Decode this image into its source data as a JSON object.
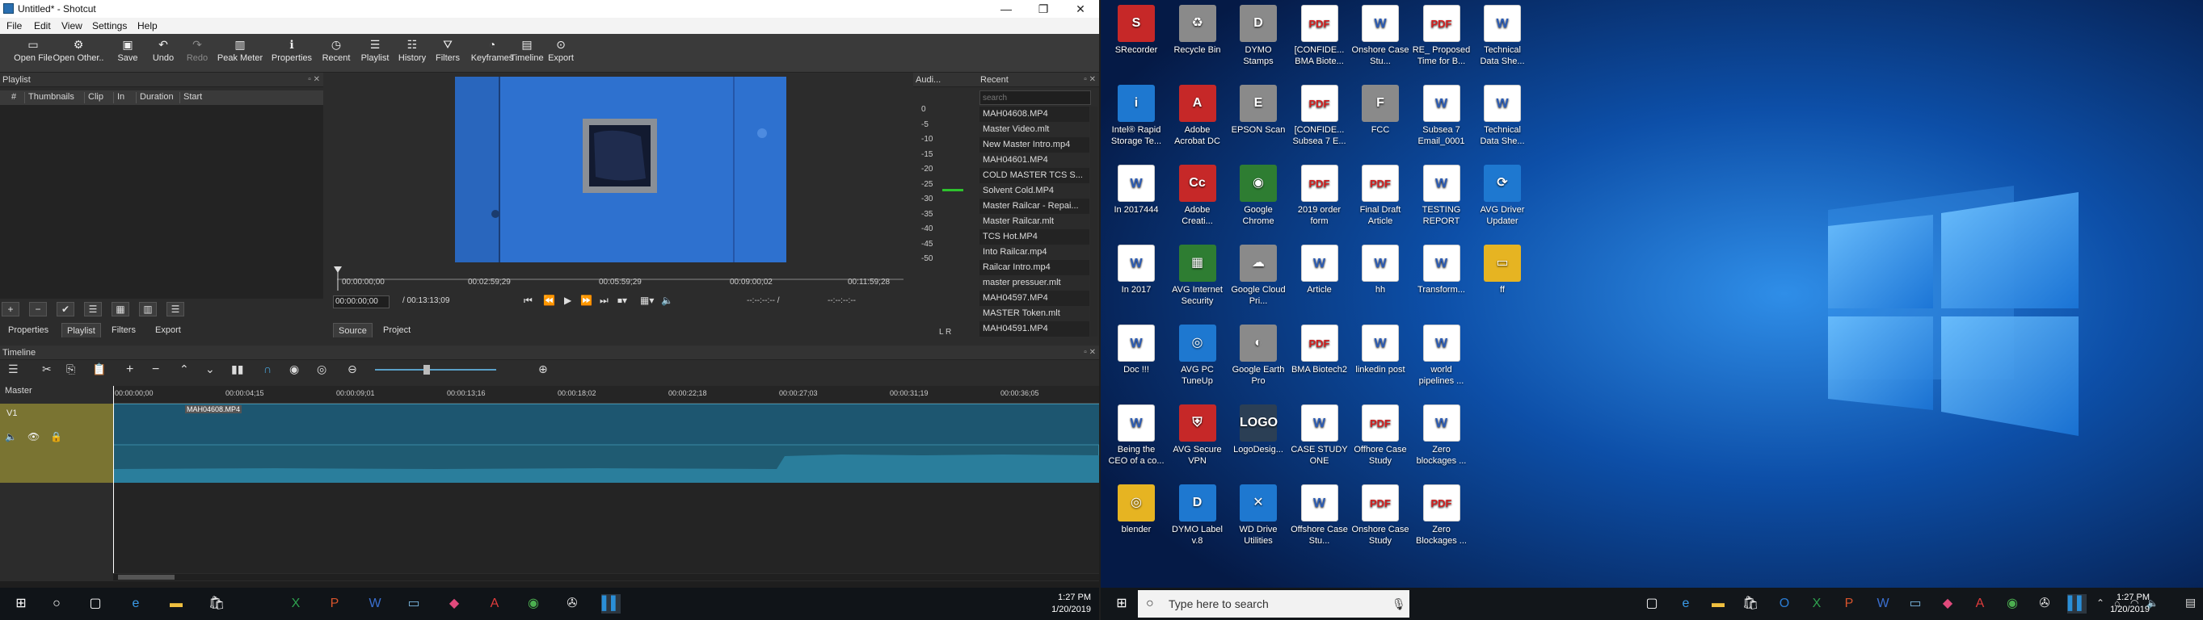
{
  "window": {
    "title": "Untitled* - Shotcut",
    "minimize": "—",
    "restore": "❐",
    "close": "✕"
  },
  "menu": [
    "File",
    "Edit",
    "View",
    "Settings",
    "Help"
  ],
  "toolbar": [
    {
      "label": "Open File",
      "icon": "open-file-icon",
      "glyph": "▭"
    },
    {
      "label": "Open Other..",
      "icon": "open-other-icon",
      "glyph": "⚙"
    },
    {
      "label": "Save",
      "icon": "save-icon",
      "glyph": "▣"
    },
    {
      "label": "Undo",
      "icon": "undo-icon",
      "glyph": "↶"
    },
    {
      "label": "Redo",
      "icon": "redo-icon",
      "glyph": "↷"
    },
    {
      "label": "Peak Meter",
      "icon": "peak-meter-icon",
      "glyph": "▥"
    },
    {
      "label": "Properties",
      "icon": "properties-icon",
      "glyph": "ℹ"
    },
    {
      "label": "Recent",
      "icon": "recent-icon",
      "glyph": "◷"
    },
    {
      "label": "Playlist",
      "icon": "playlist-icon",
      "glyph": "☰"
    },
    {
      "label": "History",
      "icon": "history-icon",
      "glyph": "☷"
    },
    {
      "label": "Filters",
      "icon": "filters-icon",
      "glyph": "⛛"
    },
    {
      "label": "Keyframes",
      "icon": "keyframes-icon",
      "glyph": "◔"
    },
    {
      "label": "Timeline",
      "icon": "timeline-icon",
      "glyph": "▤"
    },
    {
      "label": "Export",
      "icon": "export-icon",
      "glyph": "⊙"
    }
  ],
  "playlist": {
    "title": "Playlist",
    "columns": [
      "#",
      "Thumbnails",
      "Clip",
      "In",
      "Duration",
      "Start"
    ],
    "tabs": [
      "Properties",
      "Playlist",
      "Filters",
      "Export"
    ],
    "tools": [
      "+",
      "−",
      "✔",
      "☰",
      "▦",
      "▥",
      "☰"
    ]
  },
  "player": {
    "scale_ticks": [
      "00:00:00;00",
      "00:02:59;29",
      "00:05:59;29",
      "00:09:00;02",
      "00:11:59;28"
    ],
    "position": "00:00:00;00",
    "duration": "/ 00:13:13;09",
    "in_point": "--:--:--:-- /",
    "out_point": "--:--:--:--",
    "tabs": [
      "Source",
      "Project"
    ]
  },
  "audio": {
    "title": "Audi...",
    "scale": [
      "0",
      "-5",
      "-10",
      "-15",
      "-20",
      "-25",
      "-30",
      "-35",
      "-40",
      "-45",
      "-50"
    ],
    "channels": "L  R"
  },
  "recent": {
    "title": "Recent",
    "search_placeholder": "search",
    "items": [
      "MAH04608.MP4",
      "Master Video.mlt",
      "New Master Intro.mp4",
      "MAH04601.MP4",
      "COLD MASTER TCS S...",
      "Solvent Cold.MP4",
      "Master Railcar - Repai...",
      "Master Railcar.mlt",
      "TCS Hot.MP4",
      "Into Railcar.mp4",
      "Railcar Intro.mp4",
      "master pressuer.mlt",
      "MAH04597.MP4",
      "MASTER Token.mlt",
      "MAH04591.MP4"
    ]
  },
  "timeline": {
    "title": "Timeline",
    "master": "Master",
    "track": "V1",
    "clip_name": "MAH04608.MP4",
    "ruler": [
      "00:00:00;00",
      "00:00:04;15",
      "00:00:09;01",
      "00:00:13;16",
      "00:00:18;02",
      "00:00:22;18",
      "00:00:27;03",
      "00:00:31;19",
      "00:00:36;05"
    ]
  },
  "taskbar_left": {
    "time": "1:27 PM",
    "date": "1/20/2019"
  },
  "desktop": {
    "icons": [
      {
        "label": "SRecorder",
        "col": 0,
        "row": 0,
        "kind": "ico-red",
        "glyph": "S"
      },
      {
        "label": "Recycle Bin",
        "col": 1,
        "row": 0,
        "kind": "ico-gray",
        "glyph": "♻"
      },
      {
        "label": "DYMO Stamps",
        "col": 2,
        "row": 0,
        "kind": "ico-gray",
        "glyph": "D"
      },
      {
        "label": "[CONFIDE... BMA Biote...",
        "col": 3,
        "row": 0,
        "kind": "pdf",
        "glyph": "PDF"
      },
      {
        "label": "Onshore Case Stu...",
        "col": 4,
        "row": 0,
        "kind": "word",
        "glyph": "W"
      },
      {
        "label": "RE_ Proposed Time for B...",
        "col": 5,
        "row": 0,
        "kind": "pdf",
        "glyph": "PDF"
      },
      {
        "label": "Technical Data She...",
        "col": 6,
        "row": 0,
        "kind": "word",
        "glyph": "W"
      },
      {
        "label": "Intel® Rapid Storage Te...",
        "col": 0,
        "row": 1,
        "kind": "ico-blue",
        "glyph": "i"
      },
      {
        "label": "Adobe Acrobat DC",
        "col": 1,
        "row": 1,
        "kind": "ico-red",
        "glyph": "A"
      },
      {
        "label": "EPSON Scan",
        "col": 2,
        "row": 1,
        "kind": "ico-gray",
        "glyph": "E"
      },
      {
        "label": "[CONFIDE... Subsea 7 E...",
        "col": 3,
        "row": 1,
        "kind": "pdf",
        "glyph": "PDF"
      },
      {
        "label": "FCC",
        "col": 4,
        "row": 1,
        "kind": "ico-gray",
        "glyph": "F"
      },
      {
        "label": "Subsea 7 Email_0001",
        "col": 5,
        "row": 1,
        "kind": "word",
        "glyph": "W"
      },
      {
        "label": "Technical Data She...",
        "col": 6,
        "row": 1,
        "kind": "word",
        "glyph": "W"
      },
      {
        "label": "In 2017444",
        "col": 0,
        "row": 2,
        "kind": "word",
        "glyph": "W"
      },
      {
        "label": "Adobe Creati...",
        "col": 1,
        "row": 2,
        "kind": "ico-red",
        "glyph": "Cc"
      },
      {
        "label": "Google Chrome",
        "col": 2,
        "row": 2,
        "kind": "ico-grn",
        "glyph": "◉"
      },
      {
        "label": "2019 order form",
        "col": 3,
        "row": 2,
        "kind": "pdf",
        "glyph": "PDF"
      },
      {
        "label": "Final Draft Article",
        "col": 4,
        "row": 2,
        "kind": "pdf",
        "glyph": "PDF"
      },
      {
        "label": "TESTING REPORT",
        "col": 5,
        "row": 2,
        "kind": "word",
        "glyph": "W"
      },
      {
        "label": "AVG Driver Updater",
        "col": 6,
        "row": 2,
        "kind": "ico-blue",
        "glyph": "⟳"
      },
      {
        "label": "In 2017",
        "col": 0,
        "row": 3,
        "kind": "word",
        "glyph": "W"
      },
      {
        "label": "AVG Internet Security",
        "col": 1,
        "row": 3,
        "kind": "ico-grn",
        "glyph": "▦"
      },
      {
        "label": "Google Cloud Pri...",
        "col": 2,
        "row": 3,
        "kind": "ico-gray",
        "glyph": "☁"
      },
      {
        "label": "Article",
        "col": 3,
        "row": 3,
        "kind": "word",
        "glyph": "W"
      },
      {
        "label": "hh",
        "col": 4,
        "row": 3,
        "kind": "word",
        "glyph": "W"
      },
      {
        "label": "Transform...",
        "col": 5,
        "row": 3,
        "kind": "word",
        "glyph": "W"
      },
      {
        "label": "ff",
        "col": 6,
        "row": 3,
        "kind": "ico-yel",
        "glyph": "▭"
      },
      {
        "label": "Doc !!!",
        "col": 0,
        "row": 4,
        "kind": "word",
        "glyph": "W"
      },
      {
        "label": "AVG PC TuneUp",
        "col": 1,
        "row": 4,
        "kind": "ico-blue",
        "glyph": "◎"
      },
      {
        "label": "Google Earth Pro",
        "col": 2,
        "row": 4,
        "kind": "ico-gray",
        "glyph": "◐"
      },
      {
        "label": "BMA Biotech2",
        "col": 3,
        "row": 4,
        "kind": "pdf",
        "glyph": "PDF"
      },
      {
        "label": "linkedin post",
        "col": 4,
        "row": 4,
        "kind": "word",
        "glyph": "W"
      },
      {
        "label": "world pipelines ...",
        "col": 5,
        "row": 4,
        "kind": "word",
        "glyph": "W"
      },
      {
        "label": "Being the CEO of a co...",
        "col": 0,
        "row": 5,
        "kind": "word",
        "glyph": "W"
      },
      {
        "label": "AVG Secure VPN",
        "col": 1,
        "row": 5,
        "kind": "ico-red",
        "glyph": "⛨"
      },
      {
        "label": "LogoDesig...",
        "col": 2,
        "row": 5,
        "kind": "ico-dk",
        "glyph": "LOGO"
      },
      {
        "label": "CASE STUDY ONE",
        "col": 3,
        "row": 5,
        "kind": "word",
        "glyph": "W"
      },
      {
        "label": "Offhore Case Study",
        "col": 4,
        "row": 5,
        "kind": "pdf",
        "glyph": "PDF"
      },
      {
        "label": "Zero blockages ...",
        "col": 5,
        "row": 5,
        "kind": "word",
        "glyph": "W"
      },
      {
        "label": "blender",
        "col": 0,
        "row": 6,
        "kind": "ico-yel",
        "glyph": "◎"
      },
      {
        "label": "DYMO Label v.8",
        "col": 1,
        "row": 6,
        "kind": "ico-blue",
        "glyph": "D"
      },
      {
        "label": "WD Drive Utilities",
        "col": 2,
        "row": 6,
        "kind": "ico-blue",
        "glyph": "✕"
      },
      {
        "label": "Offshore Case Stu...",
        "col": 3,
        "row": 6,
        "kind": "word",
        "glyph": "W"
      },
      {
        "label": "Onshore Case Study",
        "col": 4,
        "row": 6,
        "kind": "pdf",
        "glyph": "PDF"
      },
      {
        "label": "Zero Blockages ...",
        "col": 5,
        "row": 6,
        "kind": "pdf",
        "glyph": "PDF"
      }
    ]
  },
  "taskbar_right": {
    "search_placeholder": "Type here to search",
    "time": "1:27 PM",
    "date": "1/20/2019"
  }
}
